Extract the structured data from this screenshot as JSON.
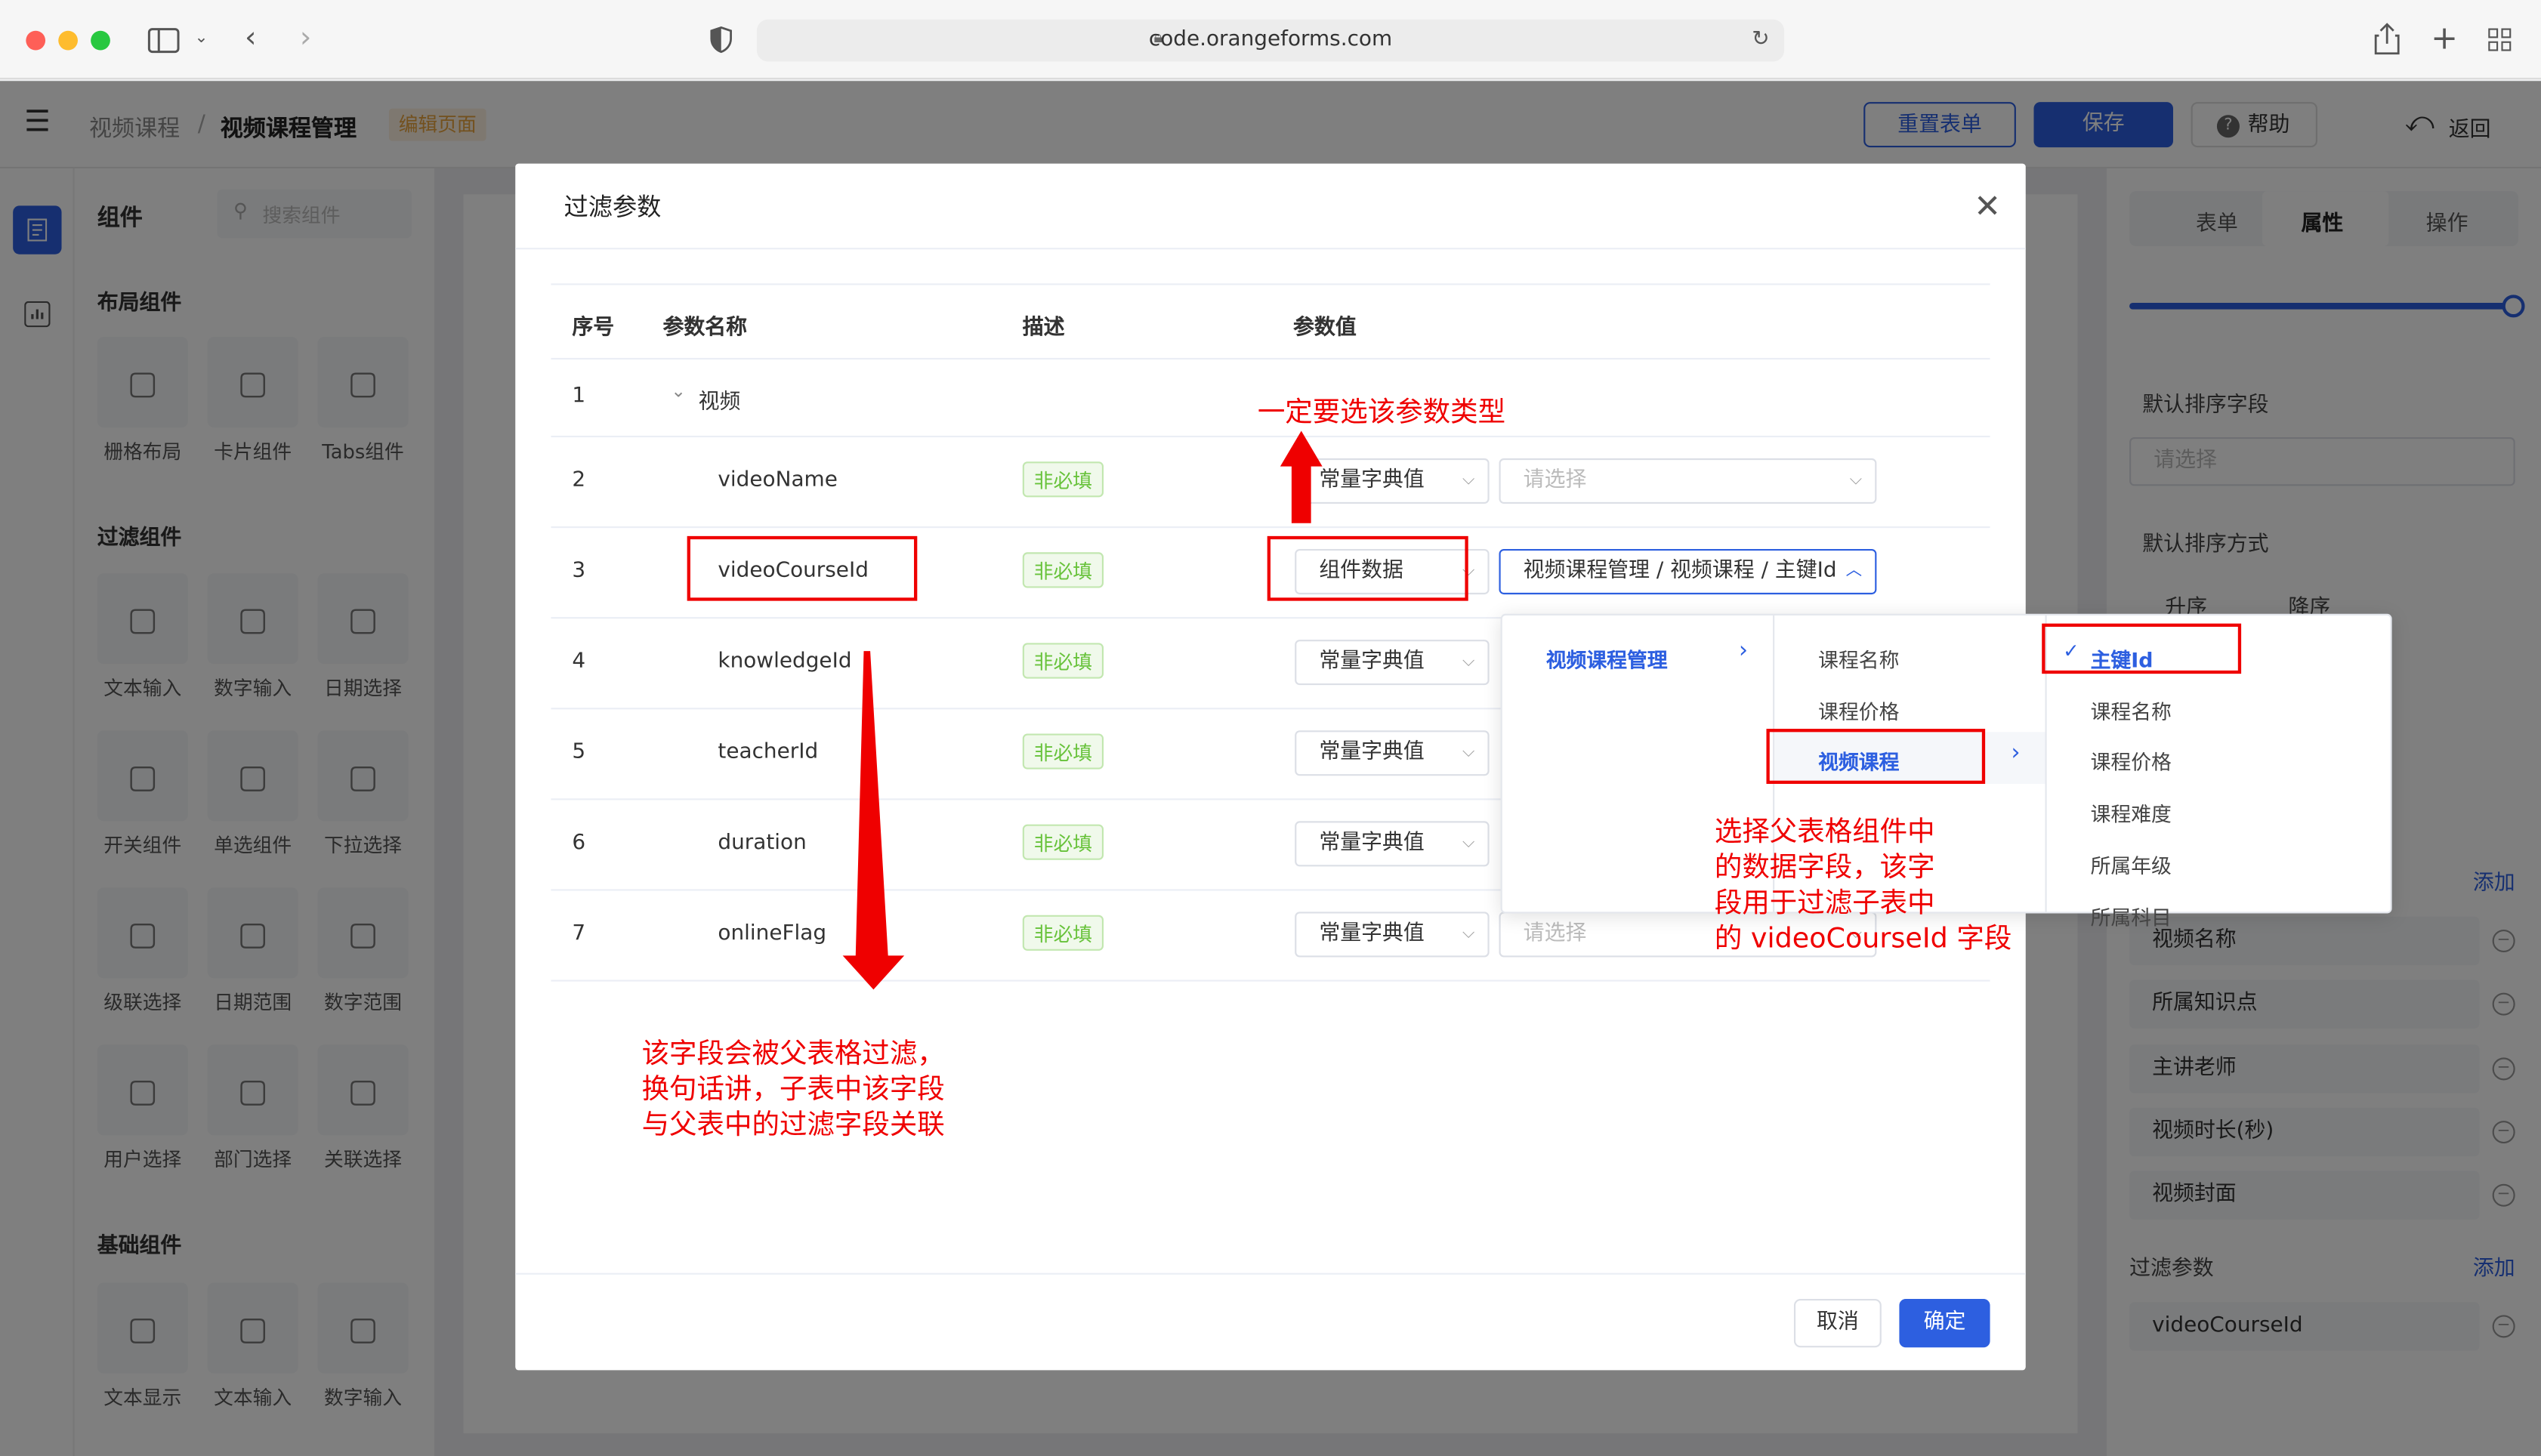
{
  "browser": {
    "url": "code.orangeforms.com"
  },
  "header": {
    "crumb_parent": "视频课程",
    "crumb_sep": "/",
    "crumb_current": "视频课程管理",
    "edit_tag": "编辑页面",
    "reset_label": "重置表单",
    "save_label": "保存",
    "help_label": "帮助",
    "back_label": "返回"
  },
  "left_panel": {
    "title": "组件",
    "search_placeholder": "搜索组件",
    "layout_section": "布局组件",
    "layout_items": [
      "栅格布局",
      "卡片组件",
      "Tabs组件"
    ],
    "filter_section": "过滤组件",
    "filter_items": [
      "文本输入",
      "数字输入",
      "日期选择",
      "开关组件",
      "单选组件",
      "下拉选择",
      "级联选择",
      "日期范围",
      "数字范围",
      "用户选择",
      "部门选择",
      "关联选择"
    ],
    "basic_section": "基础组件",
    "basic_items": [
      "文本显示",
      "文本输入",
      "数字输入"
    ]
  },
  "right_panel": {
    "tabs": [
      "表单",
      "属性",
      "操作"
    ],
    "active_tab": "属性",
    "sort_field_label": "默认排序字段",
    "sort_field_placeholder": "请选择",
    "sort_order_label": "默认排序方式",
    "sort_asc": "升序",
    "sort_desc": "降序",
    "add_link": "添加",
    "columns": [
      "视频名称",
      "所属知识点",
      "主讲老师",
      "视频时长(秒)",
      "视频封面"
    ],
    "filter_params_label": "过滤参数",
    "filter_params_add": "添加",
    "filter_params": [
      "videoCourseId"
    ]
  },
  "dialog": {
    "title": "过滤参数",
    "headers": {
      "index": "序号",
      "name": "参数名称",
      "desc": "描述",
      "value": "参数值"
    },
    "rows": [
      {
        "index": "1",
        "name": "视频",
        "badge": "",
        "type": "",
        "value": ""
      },
      {
        "index": "2",
        "name": "videoName",
        "badge": "非必填",
        "type": "常量字典值",
        "value": "请选择"
      },
      {
        "index": "3",
        "name": "videoCourseId",
        "badge": "非必填",
        "type": "组件数据",
        "value": "视频课程管理 / 视频课程 / 主键Id"
      },
      {
        "index": "4",
        "name": "knowledgeId",
        "badge": "非必填",
        "type": "常量字典值",
        "value": ""
      },
      {
        "index": "5",
        "name": "teacherId",
        "badge": "非必填",
        "type": "常量字典值",
        "value": ""
      },
      {
        "index": "6",
        "name": "duration",
        "badge": "非必填",
        "type": "常量字典值",
        "value": ""
      },
      {
        "index": "7",
        "name": "onlineFlag",
        "badge": "非必填",
        "type": "常量字典值",
        "value": "请选择"
      }
    ],
    "cancel_label": "取消",
    "confirm_label": "确定"
  },
  "cascader": {
    "col1": [
      "视频课程管理"
    ],
    "col2": [
      "课程名称",
      "课程价格",
      "视频课程"
    ],
    "col3": [
      "主键Id",
      "课程名称",
      "课程价格",
      "课程难度",
      "所属年级",
      "所属科目"
    ]
  },
  "annotations": {
    "type_note": "一定要选该参数类型",
    "field_note": [
      "该字段会被父表格过滤，",
      "换句话讲，子表中该字段",
      "与父表中的过滤字段关联"
    ],
    "data_note": [
      "选择父表格组件中",
      "的数据字段，该字",
      "段用于过滤子表中",
      "的 videoCourseId 字段"
    ]
  },
  "colors": {
    "primary": "#2d5fe0",
    "annotation": "#ef0000",
    "badge_green": "#67c23a"
  }
}
